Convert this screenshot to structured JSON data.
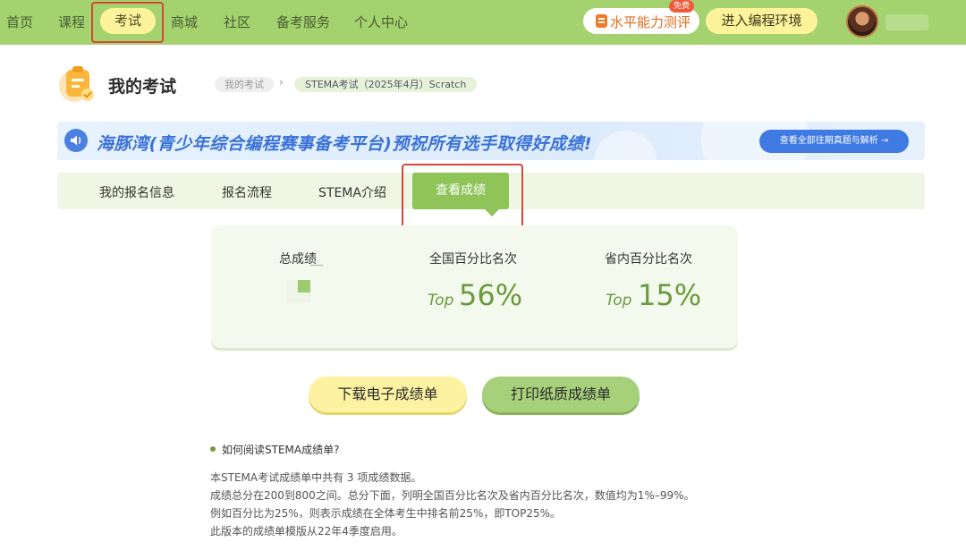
{
  "nav": {
    "items": [
      "首页",
      "课程",
      "考试",
      "商城",
      "社区",
      "备考服务",
      "个人中心"
    ],
    "active": "考试",
    "test_button": "水平能力测评",
    "free_tag": "免费",
    "env_button": "进入编程环境"
  },
  "header": {
    "title": "我的考试",
    "breadcrumb": [
      "我的考试",
      "STEMA考试（2025年4月）Scratch"
    ]
  },
  "banner": {
    "text": "海豚湾(青少年综合编程赛事备考平台)预祝所有选手取得好成绩!",
    "button": "查看全部往期真题与解析 →"
  },
  "tabs": [
    "我的报名信息",
    "报名流程",
    "STEMA介绍",
    "查看成绩"
  ],
  "scores": {
    "total_label": "总成绩",
    "national_label": "全国百分比名次",
    "provincial_label": "省内百分比名次",
    "top_word": "Top",
    "national_value": "56%",
    "provincial_value": "15%"
  },
  "actions": {
    "download": "下载电子成绩单",
    "print": "打印纸质成绩单"
  },
  "help": {
    "title": "如何阅读STEMA成绩单?",
    "lines": [
      "本STEMA考试成绩单中共有 3 项成绩数据。",
      "成绩总分在200到800之间。总分下面，列明全国百分比名次及省内百分比名次，数值均为1%–99%。",
      "例如百分比为25%，则表示成绩在全体考生中排名前25%，即TOP25%。",
      "此版本的成绩单模版从22年4季度启用。"
    ]
  },
  "colors": {
    "nav_bg": "#a4d26e",
    "accent_green": "#8ec458",
    "highlight_yellow": "#fdf39a",
    "annotation_red": "#d8463a",
    "banner_blue": "#3f7ae2"
  }
}
